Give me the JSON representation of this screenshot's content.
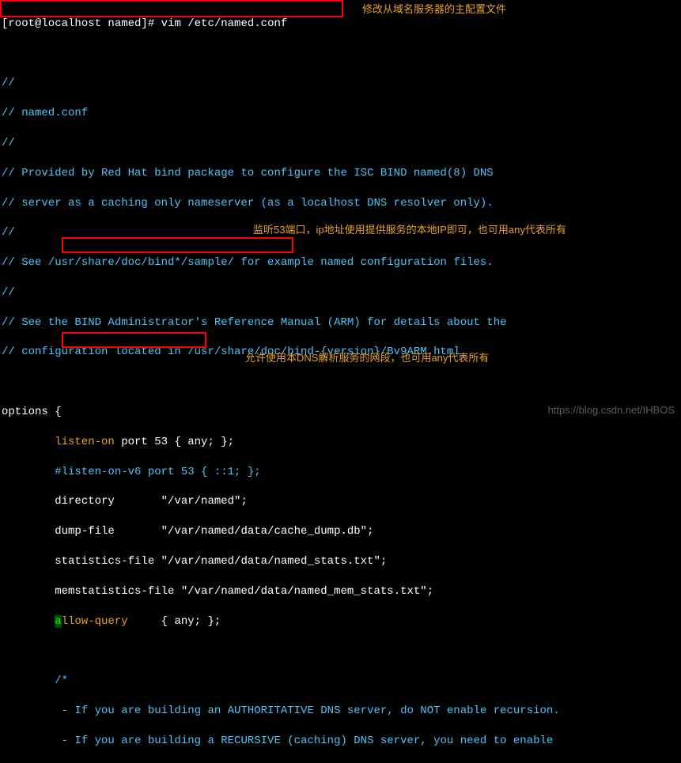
{
  "prompt": {
    "user_host": "[root@localhost named]# ",
    "command": "vim /etc/named.conf"
  },
  "annotations": {
    "ann1": "修改从域名服务器的主配置文件",
    "ann2": "监听53端口，ip地址使用提供服务的本地IP即可，也可用any代表所有",
    "ann3": "允许使用本DNS解析服务的网段，也可用any代表所有"
  },
  "file": {
    "c1": "//",
    "c2": "// named.conf",
    "c3": "//",
    "c4": "// Provided by Red Hat bind package to configure the ISC BIND named(8) DNS",
    "c5": "// server as a caching only nameserver (as a localhost DNS resolver only).",
    "c6": "//",
    "c7": "// See /usr/share/doc/bind*/sample/ for example named configuration files.",
    "c8": "//",
    "c9": "// See the BIND Administrator's Reference Manual (ARM) for details about the",
    "c10": "// configuration located in /usr/share/doc/bind-{version}/Bv9ARM.html",
    "options_open": "options {",
    "listen_on_1": "        listen-on",
    "listen_on_2": " port 53 { any; };",
    "listen_on_v6": "        #listen-on-v6 port 53 { ::1; };",
    "directory": "        directory       \"/var/named\";",
    "dump_file": "        dump-file       \"/var/named/data/cache_dump.db\";",
    "stats_file": "        statistics-file \"/var/named/data/named_stats.txt\";",
    "memstats_file": "        memstatistics-file \"/var/named/data/named_mem_stats.txt\";",
    "allow_query_cursor": "a",
    "allow_query_1": "        ",
    "allow_query_2": "llow-query",
    "allow_query_3": "     { any; };",
    "block_c1": "        /*",
    "block_c2": "         - If you are building an AUTHORITATIVE DNS server, do NOT enable recursion.",
    "block_c3": "         - If you are building a RECURSIVE (caching) DNS server, you need to enable"
  },
  "watermark": "https://blog.csdn.net/IHBOS"
}
